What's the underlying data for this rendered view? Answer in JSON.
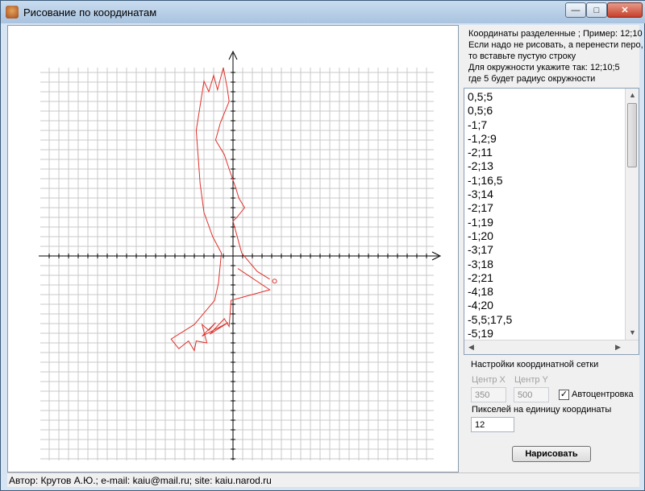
{
  "window": {
    "title": "Рисование по координатам",
    "buttons": {
      "minimize": "—",
      "maximize": "□",
      "close": "✕"
    }
  },
  "hint_lines": [
    "Координаты разделенные ; Пример: 12;10",
    "Если надо не рисовать, а перенести перо,",
    "то вставьте пустую строку",
    "Для окружности укажите так: 12;10;5",
    "где 5 будет радиус окружности"
  ],
  "coordinates_list": [
    "0,5;5",
    "0,5;6",
    "-1;7",
    "-1,2;9",
    "-2;11",
    "-2;13",
    "-1;16,5",
    "-3;14",
    "-2;17",
    "-1;19",
    "-1;20",
    "-3;17",
    "-3;18",
    "-2;21",
    "-4;18",
    "-4;20",
    "-5,5;17,5",
    "-5;19"
  ],
  "settings": {
    "title": "Настройки координатной сетки",
    "center_x_label": "Центр X",
    "center_y_label": "Центр Y",
    "center_x": "350",
    "center_y": "500",
    "autocenter_label": "Автоцентровка",
    "autocenter_checked": true,
    "pixels_label": "Пикселей на  единицу координаты",
    "pixels_value": "12",
    "draw_button": "Нарисовать"
  },
  "status": "Автор: Крутов А.Ю.;  e-mail: kaiu@mail.ru;  site: kaiu.narod.ru",
  "colors": {
    "drawing": "#e0302a",
    "grid": "#c8c8c8",
    "axis": "#000000"
  },
  "drawing_polyline": [
    [
      0.5,
      -1.3
    ],
    [
      3.8,
      -3.5
    ],
    [
      -0.2,
      -4.6
    ],
    [
      -0.4,
      -7.3
    ],
    [
      -0.9,
      -6.5
    ],
    [
      -2.4,
      -8.1
    ],
    [
      -0.5,
      -6.9
    ],
    [
      -3.2,
      -8.3
    ],
    [
      -1.8,
      -6.9
    ],
    [
      -2.5,
      -7.7
    ],
    [
      -3.2,
      -7.1
    ],
    [
      -2.7,
      -9.0
    ],
    [
      -3.8,
      -8.8
    ],
    [
      -4.0,
      -9.8
    ],
    [
      -4.6,
      -8.8
    ],
    [
      -5.6,
      -9.6
    ],
    [
      -6.4,
      -8.6
    ],
    [
      -4.0,
      -7.1
    ],
    [
      -1.9,
      -4.6
    ],
    [
      -1.5,
      -2.8
    ],
    [
      -1.2,
      0.3
    ],
    [
      -2.1,
      2.0
    ],
    [
      -3.0,
      4.5
    ],
    [
      -3.4,
      7.5
    ],
    [
      -3.8,
      13.0
    ],
    [
      -3.0,
      18.1
    ],
    [
      -2.5,
      17.0
    ],
    [
      -2.0,
      18.7
    ],
    [
      -1.6,
      17.2
    ],
    [
      -1.0,
      19.5
    ],
    [
      -0.6,
      17.4
    ],
    [
      -0.4,
      16.0
    ],
    [
      -1.3,
      13.8
    ],
    [
      -1.8,
      12.0
    ],
    [
      -0.9,
      10.5
    ],
    [
      -0.4,
      9.0
    ],
    [
      0.3,
      7.0
    ],
    [
      0.6,
      6.0
    ],
    [
      1.2,
      5.0
    ],
    [
      0.4,
      4.0
    ],
    [
      0.0,
      3.6
    ],
    [
      0.9,
      0.3
    ],
    [
      2.5,
      -1.6
    ],
    [
      3.8,
      -2.4
    ]
  ]
}
